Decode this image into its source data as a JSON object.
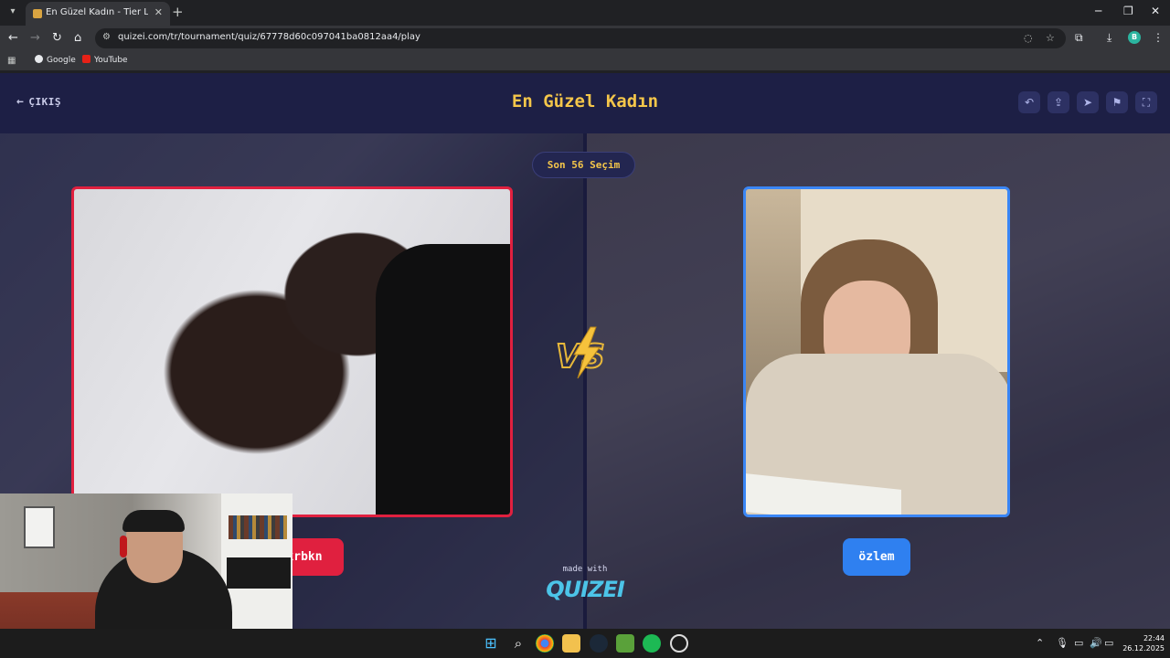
{
  "browser": {
    "tab_title": "En Güzel Kadın - Tier List, Kör S",
    "url": "quizei.com/tr/tournament/quiz/67778d60c097041ba0812aa4/play",
    "profile_initial": "B",
    "bookmarks": [
      "Google",
      "YouTube"
    ]
  },
  "page": {
    "exit_label": "ÇIKIŞ",
    "title": "En Güzel Kadın",
    "round_label": "Son 56 Seçim",
    "left_name": "krbkn",
    "right_name": "özlem",
    "made_with": "made with",
    "brand": "QUIZEI",
    "colors": {
      "title": "#f4c64a",
      "left_accent": "#e0203f",
      "right_accent": "#2f80f0",
      "brand": "#4cc4e8"
    },
    "header_icons": [
      "undo-icon",
      "share-icon",
      "send-icon",
      "flag-icon",
      "fullscreen-icon"
    ]
  },
  "taskbar": {
    "time": "22:44",
    "date": "26.12.2025"
  }
}
